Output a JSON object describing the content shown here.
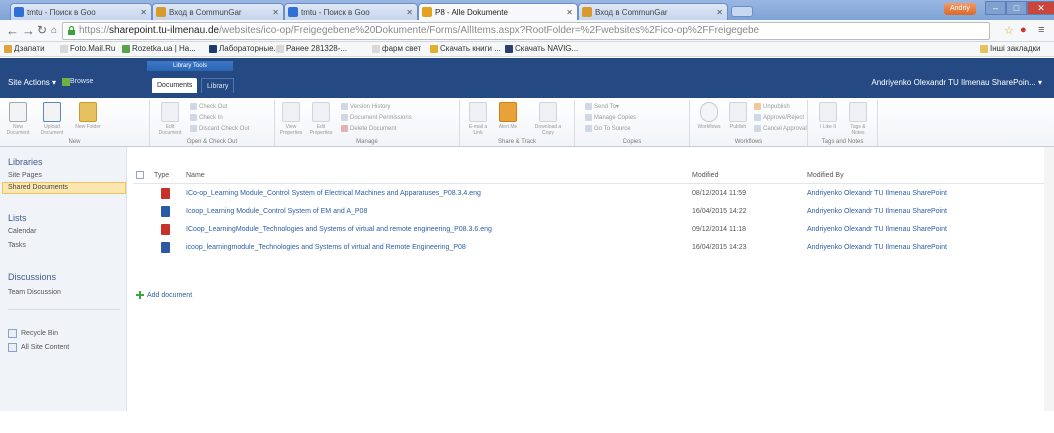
{
  "browser": {
    "tabs": [
      {
        "title": "tmtu - Поиск в Goo",
        "color": "#2f6fd6"
      },
      {
        "title": "Вход в CommunGar",
        "color": "#d79a2b"
      },
      {
        "title": "tmtu - Поиск в Goo",
        "color": "#2f6fd6"
      },
      {
        "title": "P8 - Alle Dokumente",
        "color": "#e5a21c"
      },
      {
        "title": "Вход в CommunGar",
        "color": "#d79a2b"
      }
    ],
    "user_badge": "Andriy",
    "url_scheme": "https://",
    "url_host": "sharepoint.tu-ilmenau.de",
    "url_path": "/websites/ico-op/Freigegebene%20Dokumente/Forms/AllItems.aspx?RootFolder=%2Fwebsites%2Fico-op%2FFreigegebe",
    "bookmarks": [
      "Дзапати",
      "Foto.Mail.Ru",
      "Rozetka.ua | На...",
      "Лабораторные...",
      "Ранее 281328-...",
      "фарм свет",
      "Скачать книги ...",
      "Скачать NAVIG..."
    ],
    "other_bookmarks": "Інші закладки"
  },
  "sharepoint": {
    "site_actions": "Site Actions",
    "browse_tab": "Browse",
    "library_tools": "Library Tools",
    "documents_tab": "Documents",
    "library_tab": "Library",
    "user": "Andriyenko Olexandr TU Ilmenau SharePoin..."
  },
  "ribbon": {
    "groups": [
      "New",
      "Open & Check Out",
      "Manage",
      "Share & Track",
      "Copies",
      "Workflows",
      "Tags and Notes"
    ],
    "new_document": "New Document",
    "upload_document": "Upload Document",
    "new_folder": "New Folder",
    "edit_document": "Edit Document",
    "check_out": "Check Out",
    "check_in": "Check In",
    "discard_check_out": "Discard Check Out",
    "view_properties": "View Properties",
    "edit_properties": "Edit Properties",
    "version_history": "Version History",
    "document_permissions": "Document Permissions",
    "delete_document": "Delete Document",
    "email_link": "E-mail a Link",
    "alert_me": "Alert Me",
    "download_copy": "Download a Copy",
    "send_to": "Send To",
    "manage_copies": "Manage Copies",
    "go_to_source": "Go To Source",
    "workflows": "Workflows",
    "publish": "Publish",
    "unpublish": "Unpublish",
    "approve_reject": "Approve/Reject",
    "cancel_approval": "Cancel Approval",
    "i_like_it": "I Like It",
    "tags_notes": "Tags & Notes"
  },
  "leftnav": {
    "libraries": "Libraries",
    "site_pages": "Site Pages",
    "shared_documents": "Shared Documents",
    "lists": "Lists",
    "calendar": "Calendar",
    "tasks": "Tasks",
    "discussions": "Discussions",
    "team_discussion": "Team Discussion",
    "recycle_bin": "Recycle Bin",
    "all_site_content": "All Site Content"
  },
  "list": {
    "columns": {
      "type": "Type",
      "name": "Name",
      "modified": "Modified",
      "modified_by": "Modified By"
    },
    "rows": [
      {
        "type": "pdf",
        "name": "ICo-op_Learning Module_Control System of Electrical Machines and Apparatuses_P08.3.4.eng",
        "modified": "08/12/2014 11:59",
        "modified_by": "Andriyenko Olexandr TU Ilmenau SharePoint"
      },
      {
        "type": "word",
        "name": "Icoop_Learning Module_Control System of EM and A_P08",
        "modified": "16/04/2015 14:22",
        "modified_by": "Andriyenko Olexandr TU Ilmenau SharePoint"
      },
      {
        "type": "pdf",
        "name": "ICoop_LearningModule_Technologies and Systems of virtual and remote engineering_P08.3.6.eng",
        "modified": "09/12/2014 11:18",
        "modified_by": "Andriyenko Olexandr TU Ilmenau SharePoint"
      },
      {
        "type": "word",
        "name": "icoop_learningmodule_Technologies and Systems of virtual and Remote Engineering_P08",
        "modified": "16/04/2015 14:23",
        "modified_by": "Andriyenko Olexandr TU Ilmenau SharePoint"
      }
    ],
    "add_document": "Add document"
  },
  "colors": {
    "sp_bar": "#254a83",
    "link": "#2c5ea8",
    "selected_nav": "#fde7b0",
    "pdf_icon": "#c8302a",
    "word_icon": "#2a5aa5"
  }
}
